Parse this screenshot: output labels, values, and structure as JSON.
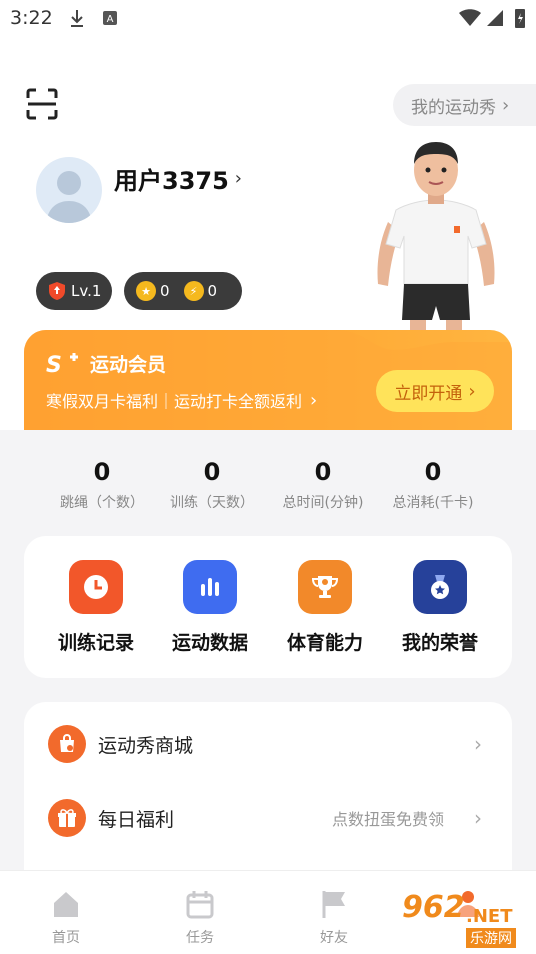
{
  "status_bar": {
    "time": "3:22"
  },
  "header": {
    "show_button_label": "我的运动秀",
    "show_chevron": "›"
  },
  "profile": {
    "username": "用户3375",
    "username_chevron": "›",
    "level": "Lv.1",
    "coins": "0",
    "energy": "0"
  },
  "member": {
    "title": "运动会员",
    "subtitle": "寒假双月卡福利｜运动打卡全额返利",
    "subtitle_chevron": "›",
    "cta_label": "立即开通",
    "cta_chevron": "›",
    "colors": {
      "banner": "#ffa52f",
      "button": "#ffe35a"
    }
  },
  "stats": [
    {
      "value": "0",
      "label": "跳绳（个数）"
    },
    {
      "value": "0",
      "label": "训练（天数）"
    },
    {
      "value": "0",
      "label": "总时间(分钟)"
    },
    {
      "value": "0",
      "label": "总消耗(千卡)"
    }
  ],
  "features": [
    {
      "label": "训练记录",
      "icon": "clock-icon",
      "color": "#f2572a"
    },
    {
      "label": "运动数据",
      "icon": "bar-chart-icon",
      "color": "#3f6cf0"
    },
    {
      "label": "体育能力",
      "icon": "trophy-icon",
      "color": "#f2892a"
    },
    {
      "label": "我的荣誉",
      "icon": "medal-icon",
      "color": "#26419a"
    }
  ],
  "list": [
    {
      "label": "运动秀商城",
      "extra": "",
      "icon": "shop-bag-icon",
      "chevron": "›"
    },
    {
      "label": "每日福利",
      "extra": "点数扭蛋免费领",
      "icon": "gift-icon",
      "chevron": "›"
    }
  ],
  "nav": [
    {
      "label": "首页",
      "icon": "home-icon"
    },
    {
      "label": "任务",
      "icon": "calendar-icon"
    },
    {
      "label": "好友",
      "icon": "flag-icon"
    }
  ],
  "watermark": {
    "brand": "962",
    "suffix": ".NET",
    "sub": "乐游网"
  }
}
